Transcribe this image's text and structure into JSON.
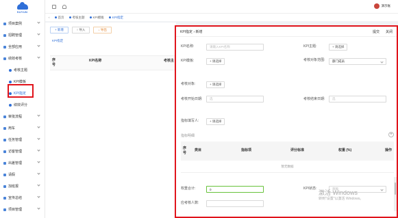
{
  "logo": {
    "brand": "SUYUN"
  },
  "sidebar": {
    "items": [
      {
        "label": "项目案例",
        "level": 1,
        "chevron": true
      },
      {
        "label": "招聘管理",
        "level": 1,
        "chevron": true
      },
      {
        "label": "全部应用",
        "level": 1,
        "chevron": true
      },
      {
        "label": "绩效考核",
        "level": 1,
        "chevron": true
      },
      {
        "label": "考核主题",
        "level": 2,
        "chevron": false
      },
      {
        "label": "KPI模板",
        "level": 2,
        "chevron": false
      },
      {
        "label": "KPI指定",
        "level": 2,
        "chevron": false,
        "active": true
      },
      {
        "label": "绩效评分",
        "level": 2,
        "chevron": false
      },
      {
        "label": "审批流程",
        "level": 1,
        "chevron": true
      },
      {
        "label": "用车",
        "level": 1,
        "chevron": true
      },
      {
        "label": "任务管理",
        "level": 1,
        "chevron": true
      },
      {
        "label": "访客管理",
        "level": 1,
        "chevron": true
      },
      {
        "label": "出差管理",
        "level": 1,
        "chevron": true
      },
      {
        "label": "请假",
        "level": 1,
        "chevron": true
      },
      {
        "label": "加班报",
        "level": 1,
        "chevron": true
      },
      {
        "label": "宣传总结",
        "level": 1,
        "chevron": true
      },
      {
        "label": "项目管理",
        "level": 1,
        "chevron": true
      }
    ]
  },
  "header": {
    "user": "演示账"
  },
  "tabs": [
    {
      "label": "首页",
      "active": false
    },
    {
      "label": "考核主题",
      "active": false
    },
    {
      "label": "KPI模板",
      "active": false
    },
    {
      "label": "KPI指定",
      "active": true
    }
  ],
  "tabs_prefix": "‹",
  "toolbar": {
    "new": "新增",
    "import": "导入",
    "export": "导出"
  },
  "list": {
    "subtab": "KPI指定",
    "col_seq": "序号",
    "col_name": "KPI名称",
    "col_theme": "考核主"
  },
  "panel": {
    "breadcrumb": "KPI指定 › 新增",
    "submit": "提交",
    "close": "关闭",
    "kpi_name_label": "KPI名称:",
    "kpi_name_placeholder": "请输入KPI名称",
    "kpi_theme_label": "KPI主题:",
    "select_btn": "+ 请选择",
    "kpi_template_label": "KPI模板:",
    "target_scope_label": "考核对象范围:",
    "target_scope_value": "部门成员",
    "target_object_label": "考核对象:",
    "start_date_label": "考核开始日期:",
    "end_date_label": "考核结束日期:",
    "date_placeholder": "选",
    "indicator_person_label": "指标填写人:",
    "section_title": "指标明细",
    "table": {
      "seq": "序号",
      "category": "类目",
      "indicator": "指标项",
      "criteria": "评分标准",
      "weight": "权重 (%)",
      "op": "操作",
      "empty": "暂无数据"
    },
    "weight_total_label": "权重合计:",
    "weight_total_value": "0",
    "kpi_status_label": "KPI状态:",
    "kpi_status_value": "草稿",
    "assessor_count_label": "应考核人数:"
  },
  "watermark": {
    "line1": "激活 Windows",
    "line2": "转到\"设置\"以激活 Windows。"
  },
  "colors": {
    "accent": "#2f6fd8",
    "highlight": "#e0131b",
    "success": "#67c23a"
  }
}
